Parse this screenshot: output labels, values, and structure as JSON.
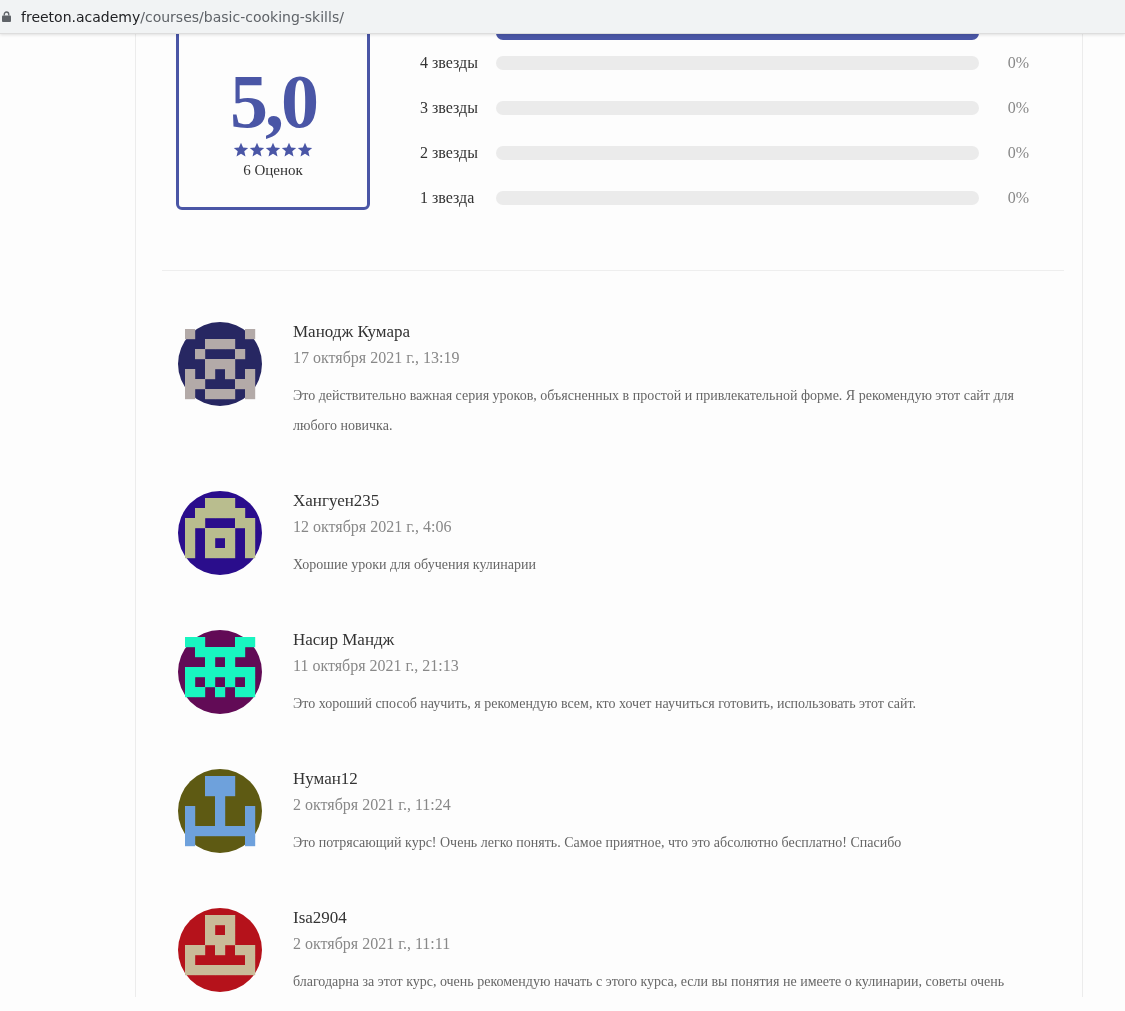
{
  "address_bar": {
    "domain": "freeton.academy",
    "path": "/courses/basic-cooking-skills/"
  },
  "rating": {
    "score": "5,0",
    "stars": 5,
    "count": "6 Оценок",
    "top_bar": {
      "level": 1
    },
    "bars": [
      {
        "label": "4 звезды",
        "percent": "0%"
      },
      {
        "label": "3 звезды",
        "percent": "0%"
      },
      {
        "label": "2 звезды",
        "percent": "0%"
      },
      {
        "label": "1 звезда",
        "percent": "0%"
      }
    ]
  },
  "reviews": [
    {
      "author": "Манодж Кумара",
      "date": "17 октября 2021 г., 13:19",
      "text": "Это действительно важная серия уроков, объясненных в простой и привлекательной форме. Я рекомендую этот сайт для любого новичка.",
      "color": "#272762"
    },
    {
      "author": "Хангуен235",
      "date": "12 октября 2021 г., 4:06",
      "text": "Хорошие уроки для обучения кулинарии",
      "color": "#2a0d8c"
    },
    {
      "author": "Насир Мандж",
      "date": "11 октября 2021 г., 21:13",
      "text": "Это хороший способ научить, я рекомендую всем, кто хочет научиться готовить, использовать этот сайт.",
      "color": "#620b56"
    },
    {
      "author": "Нуман12",
      "date": "2 октября 2021 г., 11:24",
      "text": "Это потрясающий курс! Очень легко понять. Самое приятное, что это абсолютно бесплатно! Спасибо",
      "color": "#5e5a13"
    },
    {
      "author": "Isa2904",
      "date": "2 октября 2021 г., 11:11",
      "text": "благодарна за этот курс, очень рекомендую начать с этого курса, если вы понятия не имеете о кулинарии, советы очень",
      "color": "#b5121b"
    }
  ]
}
